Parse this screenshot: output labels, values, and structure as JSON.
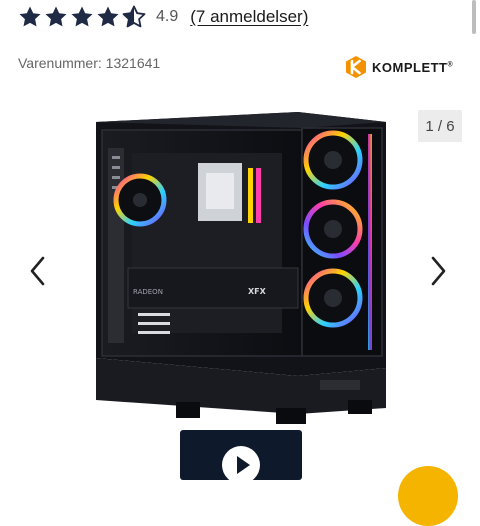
{
  "rating": {
    "stars_filled": 4.5,
    "stars_total": 5,
    "value": "4.9",
    "reviews_link": "(7 anmeldelser)"
  },
  "product": {
    "sku_label": "Varenummer",
    "sku_value": "1321641",
    "brand": "KOMPLETT",
    "brand_mark": "®"
  },
  "gallery": {
    "counter": "1 / 6",
    "prev_icon": "chevron-left-icon",
    "next_icon": "chevron-right-icon",
    "image_alt": "Gaming PC med RGB-vifter"
  },
  "colors": {
    "star": "#1f2a44",
    "brand_orange": "#f39200",
    "accent_yellow": "#f5b400"
  }
}
